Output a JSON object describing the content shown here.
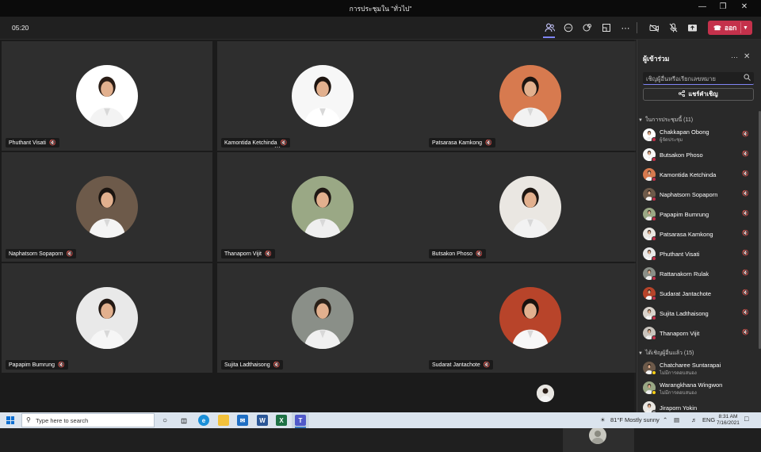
{
  "window": {
    "title": "การประชุมใน \"ทั่วไป\"",
    "minimize_icon": "minimize-icon",
    "maximize_icon": "restore-icon",
    "close_icon": "close-icon"
  },
  "toolbar": {
    "timer": "05:20",
    "leave_label": "ออก",
    "icons": [
      "people-icon",
      "chat-icon",
      "reactions-icon",
      "rooms-icon",
      "more-icon",
      "camera-off-icon",
      "mic-off-icon",
      "share-icon"
    ]
  },
  "grid": [
    {
      "name": "Phuthant Visati",
      "muted": true
    },
    {
      "name": "Kamontida Ketchinda",
      "muted": true,
      "more": "⋯"
    },
    {
      "name": "Patsarasa Kamkong",
      "muted": true
    },
    {
      "name": "Naphatsorn Sopaporn",
      "muted": true
    },
    {
      "name": "Thanaporn Vijit",
      "muted": true
    },
    {
      "name": "Butsakon Phoso",
      "muted": true
    },
    {
      "name": "Papapim Bumrung",
      "muted": true
    },
    {
      "name": "Sujita Ladthaisong",
      "muted": true
    },
    {
      "name": "Sudarat Jantachote",
      "muted": true
    }
  ],
  "panel": {
    "title": "ผู้เข้าร่วม",
    "search_placeholder": "เชิญผู้อื่นหรือเรียกเลขหมาย",
    "share_label": "แชร์คำเชิญ",
    "in_meeting_header": "ในการประชุมนี้ (11)",
    "invited_header": "ได้เชิญผู้อื่นแล้ว (15)",
    "in_meeting": [
      {
        "name": "Chakkapan Obong",
        "sub": "ผู้จัดประชุม"
      },
      {
        "name": "Butsakon Phoso",
        "sub": ""
      },
      {
        "name": "Kamontida Ketchinda",
        "sub": ""
      },
      {
        "name": "Naphatsorn Sopaporn",
        "sub": ""
      },
      {
        "name": "Papapim Bumrung",
        "sub": ""
      },
      {
        "name": "Patsarasa Kamkong",
        "sub": ""
      },
      {
        "name": "Phuthant Visati",
        "sub": ""
      },
      {
        "name": "Rattanakorn Rulak",
        "sub": ""
      },
      {
        "name": "Sudarat Jantachote",
        "sub": ""
      },
      {
        "name": "Sujita Ladthaisong",
        "sub": ""
      },
      {
        "name": "Thanaporn Vijit",
        "sub": ""
      }
    ],
    "invited": [
      {
        "name": "Chatcharee Suntarapai",
        "sub": "ไม่มีการตอบสนอง"
      },
      {
        "name": "Warangkhana Wingwon",
        "sub": "ไม่มีการตอบสนอง"
      },
      {
        "name": "Jiraporn Yokin",
        "sub": ""
      }
    ]
  },
  "taskbar": {
    "search_placeholder": "Type here to search",
    "weather": "81°F  Mostly sunny",
    "language": "ENG",
    "time": "8:31 AM",
    "date": "7/16/2021"
  }
}
